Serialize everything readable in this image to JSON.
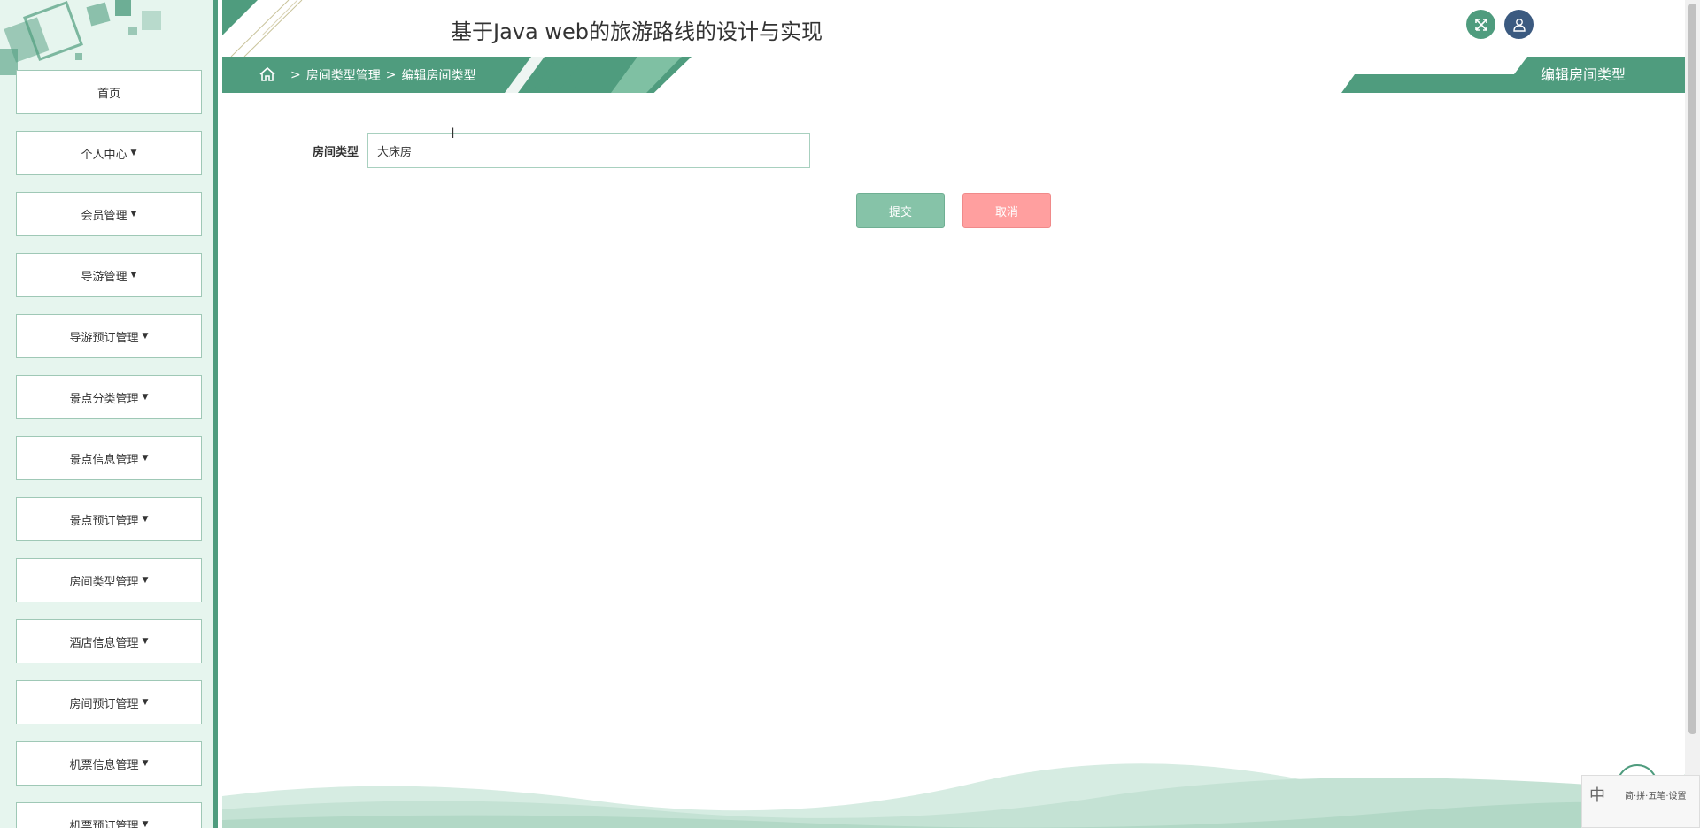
{
  "app": {
    "title": "基于Java web的旅游路线的设计与实现"
  },
  "breadcrumb": {
    "items": [
      "房间类型管理",
      "编辑房间类型"
    ],
    "separator": ">"
  },
  "page_tag": {
    "label": "编辑房间类型"
  },
  "sidebar": {
    "items": [
      {
        "label": "首页",
        "has_caret": false
      },
      {
        "label": "个人中心",
        "has_caret": true
      },
      {
        "label": "会员管理",
        "has_caret": true
      },
      {
        "label": "导游管理",
        "has_caret": true
      },
      {
        "label": "导游预订管理",
        "has_caret": true
      },
      {
        "label": "景点分类管理",
        "has_caret": true
      },
      {
        "label": "景点信息管理",
        "has_caret": true
      },
      {
        "label": "景点预订管理",
        "has_caret": true
      },
      {
        "label": "房间类型管理",
        "has_caret": true
      },
      {
        "label": "酒店信息管理",
        "has_caret": true
      },
      {
        "label": "房间预订管理",
        "has_caret": true
      },
      {
        "label": "机票信息管理",
        "has_caret": true
      },
      {
        "label": "机票预订管理",
        "has_caret": true
      }
    ]
  },
  "form": {
    "room_type_label": "房间类型",
    "room_type_value": "大床房",
    "submit_label": "提交",
    "cancel_label": "取消"
  },
  "ime": {
    "char": "中",
    "text": "简·拼·五笔·设置"
  },
  "colors": {
    "primary": "#4f9c7e",
    "sidebar_bg": "#e6f5ee",
    "submit": "#86c3a8",
    "cancel": "#ff9f9f",
    "user_btn": "#3b5a80"
  },
  "icons": {
    "home": "home-icon",
    "fullscreen": "fullscreen-icon",
    "user": "user-icon",
    "caret": "caret-down-icon"
  }
}
